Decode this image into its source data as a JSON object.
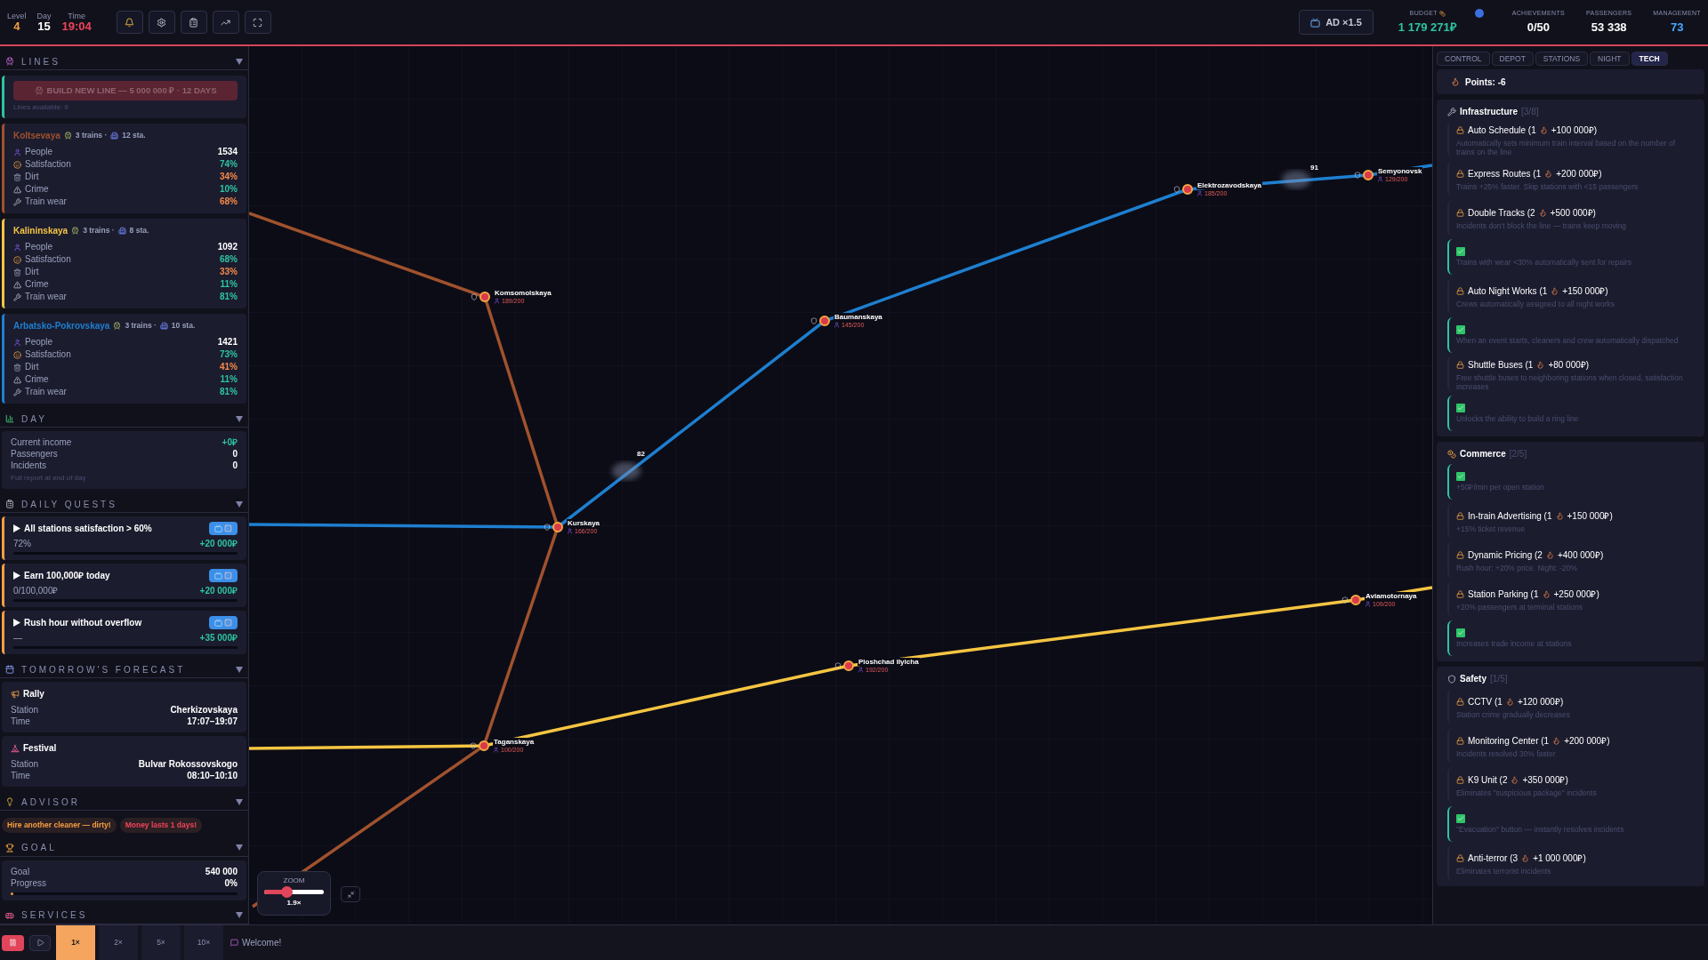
{
  "top_bar": {
    "stats": [
      {
        "label": "Level",
        "value": "4",
        "color": "#f59e42"
      },
      {
        "label": "Day",
        "value": "15",
        "color": "#ffffff"
      },
      {
        "label": "Time",
        "value": "19:04",
        "color": "#f0445a"
      }
    ],
    "tools": [
      {
        "kind": "bell"
      },
      {
        "kind": "gear"
      },
      {
        "kind": "clipboard"
      },
      {
        "kind": "chart"
      },
      {
        "kind": "fullscreen"
      }
    ],
    "ad_button": "AD ×1.5",
    "budget": {
      "label": "BUDGET",
      "value": "1 179 271₽"
    },
    "counters": [
      {
        "label": "ACHIEVEMENTS",
        "value": "0/50",
        "color": "#ffffff"
      },
      {
        "label": "PASSENGERS",
        "value": "53 338",
        "color": "#ffffff"
      },
      {
        "label": "MANAGEMENT",
        "value": "73",
        "color": "#4aa8ff"
      }
    ]
  },
  "sidebar": {
    "lines_section": {
      "title": "LINES",
      "build_button": "BUILD NEW LINE — 5 000 000 ₽ · 12 DAYS",
      "build_disabled": true,
      "available": "Lines available: 9",
      "lines": [
        {
          "name": "Koltsevaya",
          "color": "#a0522d",
          "trains": "3 trains ·",
          "stations": "12 sta.",
          "stats": [
            {
              "kind": "people",
              "label": "People",
              "value": "1534",
              "color": "#ffffff"
            },
            {
              "kind": "satisfaction",
              "label": "Satisfaction",
              "value": "74%",
              "color": "#2ec4a0"
            },
            {
              "kind": "dirt",
              "label": "Dirt",
              "value": "34%",
              "color": "#f5894a"
            },
            {
              "kind": "crime",
              "label": "Crime",
              "value": "10%",
              "color": "#2ec4a0"
            },
            {
              "kind": "wear",
              "label": "Train wear",
              "value": "68%",
              "color": "#f5894a"
            }
          ]
        },
        {
          "name": "Kalininskaya",
          "color": "#f5c542",
          "trains": "3 trains ·",
          "stations": "8 sta.",
          "stats": [
            {
              "kind": "people",
              "label": "People",
              "value": "1092",
              "color": "#ffffff"
            },
            {
              "kind": "satisfaction",
              "label": "Satisfaction",
              "value": "68%",
              "color": "#2ec4a0"
            },
            {
              "kind": "dirt",
              "label": "Dirt",
              "value": "33%",
              "color": "#f5894a"
            },
            {
              "kind": "crime",
              "label": "Crime",
              "value": "11%",
              "color": "#2ec4a0"
            },
            {
              "kind": "wear",
              "label": "Train wear",
              "value": "81%",
              "color": "#2ec4a0"
            }
          ]
        },
        {
          "name": "Arbatsko-Pokrovskaya",
          "color": "#1e7fd0",
          "trains": "3 trains ·",
          "stations": "10 sta.",
          "stats": [
            {
              "kind": "people",
              "label": "People",
              "value": "1421",
              "color": "#ffffff"
            },
            {
              "kind": "satisfaction",
              "label": "Satisfaction",
              "value": "73%",
              "color": "#2ec4a0"
            },
            {
              "kind": "dirt",
              "label": "Dirt",
              "value": "41%",
              "color": "#f5894a"
            },
            {
              "kind": "crime",
              "label": "Crime",
              "value": "11%",
              "color": "#2ec4a0"
            },
            {
              "kind": "wear",
              "label": "Train wear",
              "value": "81%",
              "color": "#2ec4a0"
            }
          ]
        }
      ]
    },
    "day_section": {
      "title": "DAY",
      "rows": [
        {
          "label": "Current income",
          "value": "+0₽",
          "color": "#2ec4a0"
        },
        {
          "label": "Passengers",
          "value": "0",
          "color": "#ffffff"
        },
        {
          "label": "Incidents",
          "value": "0",
          "color": "#ffffff"
        }
      ],
      "note": "Full report at end of day"
    },
    "quests_section": {
      "title": "DAILY QUESTS",
      "quests": [
        {
          "title": "All stations satisfaction > 60%",
          "progress": "72%",
          "reward": "+20 000₽",
          "level": 0
        },
        {
          "title": "Earn 100,000₽ today",
          "progress": "0/100,000₽",
          "reward": "+20 000₽",
          "level": 0
        },
        {
          "title": "Rush hour without overflow",
          "progress": "—",
          "reward": "+35 000₽",
          "level": 0
        }
      ]
    },
    "forecast_section": {
      "title": "TOMORROW'S FORECAST",
      "events": [
        {
          "kind": "rally",
          "name": "Rally",
          "rows": [
            {
              "label": "Station",
              "value": "Cherkizovskaya"
            },
            {
              "label": "Time",
              "value": "17:07–19:07"
            }
          ]
        },
        {
          "kind": "festival",
          "name": "Festival",
          "rows": [
            {
              "label": "Station",
              "value": "Bulvar Rokossovskogo"
            },
            {
              "label": "Time",
              "value": "08:10–10:10"
            }
          ]
        }
      ]
    },
    "advisor_section": {
      "title": "ADVISOR",
      "tips": [
        {
          "text": "Hire another cleaner — dirty!",
          "color": "#f59e42"
        },
        {
          "text": "Money lasts 1 days!",
          "color": "#f0445a"
        }
      ]
    },
    "goal_section": {
      "title": "GOAL",
      "rows": [
        {
          "label": "Goal",
          "value": "540 000"
        },
        {
          "label": "Progress",
          "value": "0%"
        }
      ],
      "level": 0.01
    },
    "services_section": {
      "title": "SERVICES"
    }
  },
  "map": {
    "lines": [
      {
        "color": "#a0522d"
      },
      {
        "color": "#1e7fd0"
      },
      {
        "color": "#f5c542"
      }
    ],
    "stations": [
      {
        "name": "Komsomolskaya",
        "load": "189/200"
      },
      {
        "name": "Kurskaya",
        "load": "166/200"
      },
      {
        "name": "Baumanskaya",
        "load": "145/200"
      },
      {
        "name": "Elektrozavodskaya",
        "load": "185/200"
      },
      {
        "name": "Semyonovsk",
        "load": "129/200"
      },
      {
        "name": "Taganskaya",
        "load": "100/200"
      },
      {
        "name": "Ploshchad Ilyicha",
        "load": "192/200"
      },
      {
        "name": "Aviamotornaya",
        "load": "109/200"
      }
    ],
    "trains": [
      {
        "label": "82"
      },
      {
        "label": "91"
      }
    ],
    "zoom": {
      "title": "ZOOM",
      "value": "1.9×",
      "level": 0.38
    }
  },
  "right_panel": {
    "tabs": [
      {
        "label": "CONTROL",
        "selected": false
      },
      {
        "label": "DEPOT",
        "selected": false
      },
      {
        "label": "STATIONS",
        "selected": false
      },
      {
        "label": "NIGHT",
        "selected": false
      },
      {
        "label": "TECH",
        "selected": true
      }
    ],
    "points": "Points: -6",
    "categories": [
      {
        "kind": "infrastructure",
        "name": "Infrastructure",
        "count": "[3/8]",
        "items": [
          {
            "kind": "locked",
            "title": "Auto Schedule (1",
            "price": "+100 000₽)",
            "desc": "Automatically sets minimum train interval based on the number of trains on the line"
          },
          {
            "kind": "locked",
            "title": "Express Routes (1",
            "price": "+200 000₽)",
            "desc": "Trains +25% faster. Skip stations with <15 passengers"
          },
          {
            "kind": "locked",
            "title": "Double Tracks (2",
            "price": "+500 000₽)",
            "desc": "Incidents don't block the line — trains keep moving"
          },
          {
            "kind": "done",
            "desc": "Trains with wear <30% automatically sent for repairs"
          },
          {
            "kind": "locked",
            "title": "Auto Night Works (1",
            "price": "+150 000₽)",
            "desc": "Crews automatically assigned to all night works"
          },
          {
            "kind": "done",
            "desc": "When an event starts, cleaners and crew automatically dispatched"
          },
          {
            "kind": "locked",
            "title": "Shuttle Buses (1",
            "price": "+80 000₽)",
            "desc": "Free shuttle buses to neighboring stations when closed, satisfaction increases"
          },
          {
            "kind": "done",
            "desc": "Unlocks the ability to build a ring line"
          }
        ]
      },
      {
        "kind": "commerce",
        "name": "Commerce",
        "count": "[2/5]",
        "items": [
          {
            "kind": "done",
            "desc": "+50₽/min per open station"
          },
          {
            "kind": "locked",
            "title": "In-train Advertising (1",
            "price": "+150 000₽)",
            "desc": "+15% ticket revenue"
          },
          {
            "kind": "locked",
            "title": "Dynamic Pricing (2",
            "price": "+400 000₽)",
            "desc": "Rush hour: +20% price. Night: -20%"
          },
          {
            "kind": "locked",
            "title": "Station Parking (1",
            "price": "+250 000₽)",
            "desc": "+20% passengers at terminal stations"
          },
          {
            "kind": "done",
            "desc": "Increases trade income at stations"
          }
        ]
      },
      {
        "kind": "safety",
        "name": "Safety",
        "count": "[1/5]",
        "items": [
          {
            "kind": "locked",
            "title": "CCTV (1",
            "price": "+120 000₽)",
            "desc": "Station crime gradually decreases"
          },
          {
            "kind": "locked",
            "title": "Monitoring Center (1",
            "price": "+200 000₽)",
            "desc": "Incidents resolved 30% faster"
          },
          {
            "kind": "locked",
            "title": "K9 Unit (2",
            "price": "+350 000₽)",
            "desc": "Eliminates \"suspicious package\" incidents"
          },
          {
            "kind": "done",
            "desc": "\"Evacuation\" button — instantly resolves incidents"
          },
          {
            "kind": "locked",
            "title": "Anti-terror (3",
            "price": "+1 000 000₽)",
            "desc": "Eliminates terrorist incidents"
          }
        ]
      }
    ]
  },
  "bottom_bar": {
    "paused": true,
    "speeds": [
      {
        "label": "1×",
        "selected": true
      },
      {
        "label": "2×",
        "selected": false
      },
      {
        "label": "5×",
        "selected": false
      },
      {
        "label": "10×",
        "selected": false
      }
    ],
    "message": "Welcome!"
  }
}
